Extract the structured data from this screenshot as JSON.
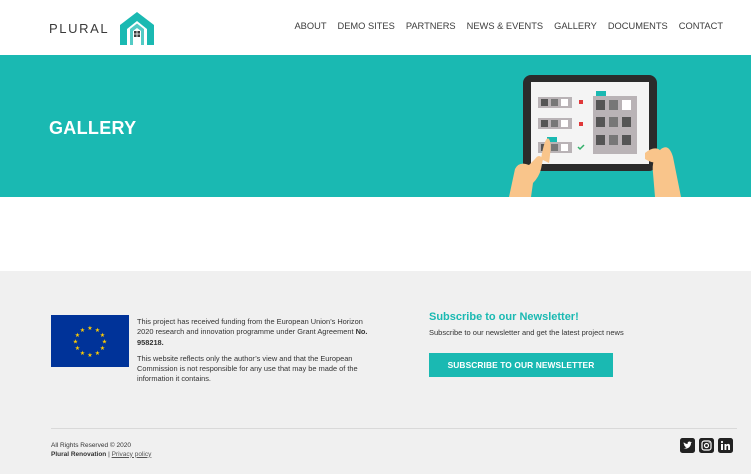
{
  "header": {
    "logo_text": "PLURAL",
    "nav": [
      "ABOUT",
      "DEMO SITES",
      "PARTNERS",
      "NEWS & EVENTS",
      "GALLERY",
      "DOCUMENTS",
      "CONTACT"
    ]
  },
  "hero": {
    "title": "GALLERY"
  },
  "footer": {
    "funding_text_1a": "This project has received funding from the European Union’s Horizon 2020 research and innovation programme under Grant Agreement",
    "funding_agreement": "No. 958218.",
    "funding_text_2": "This website reflects only the author’s view and that the European Commission is not responsible for any use that may be made of the information it contains.",
    "newsletter_title": "Subscribe to our Newsletter!",
    "newsletter_desc": "Subscribe to our newsletter and get the latest project news",
    "subscribe_button": "SUBSCRIBE TO OUR NEWSLETTER",
    "copyright": "All Rights Reserved © 2020",
    "company": "Plural Renovation",
    "separator": "|",
    "privacy_link": "Privacy policy",
    "social_icons": [
      "twitter-icon",
      "instagram-icon",
      "linkedin-icon"
    ]
  },
  "colors": {
    "brand_teal": "#1ab9b2",
    "footer_bg": "#f0f0f0",
    "eu_blue": "#003399",
    "eu_gold": "#ffcc00"
  }
}
